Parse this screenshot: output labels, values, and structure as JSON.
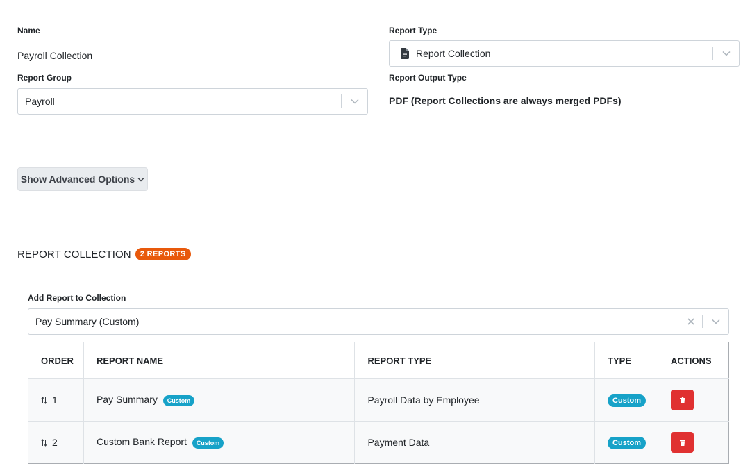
{
  "form": {
    "name_label": "Name",
    "name_value": "Payroll Collection",
    "report_type_label": "Report Type",
    "report_type_value": "Report Collection",
    "report_group_label": "Report Group",
    "report_group_value": "Payroll",
    "output_type_label": "Report Output Type",
    "output_type_value": "PDF (Report Collections are always merged PDFs)"
  },
  "advanced": {
    "button_label": "Show Advanced Options"
  },
  "collection": {
    "title": "REPORT COLLECTION",
    "count_badge": "2 REPORTS",
    "add_label": "Add Report to Collection",
    "add_value": "Pay Summary (Custom)"
  },
  "table": {
    "headers": [
      "ORDER",
      "REPORT NAME",
      "REPORT TYPE",
      "TYPE",
      "ACTIONS"
    ],
    "rows": [
      {
        "order": "1",
        "name": "Pay Summary",
        "name_badge": "Custom",
        "report_type": "Payroll Data by Employee",
        "type": "Custom"
      },
      {
        "order": "2",
        "name": "Custom Bank Report",
        "name_badge": "Custom",
        "report_type": "Payment Data",
        "type": "Custom"
      }
    ]
  },
  "colors": {
    "accent_orange": "#e8590c",
    "badge_cyan": "#17a2c8",
    "danger": "#e03131"
  }
}
